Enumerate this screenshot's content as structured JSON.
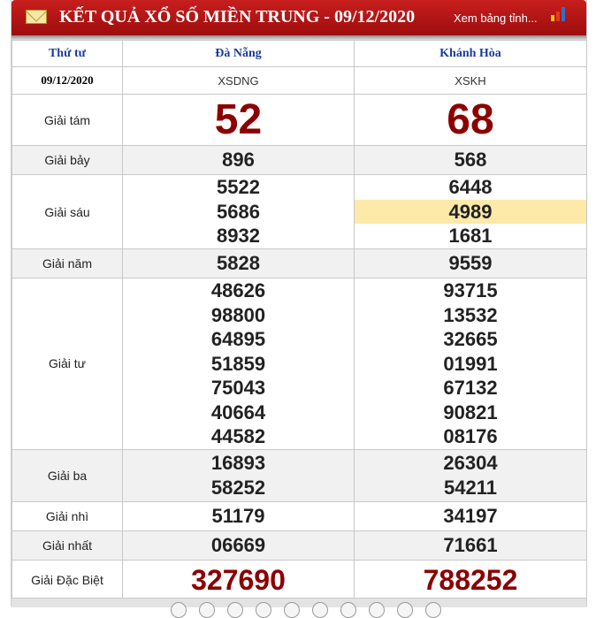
{
  "header": {
    "title": "KẾT QUẢ XỔ SỐ MIỀN TRUNG - 09/12/2020",
    "more_link": "Xem bảng tỉnh...",
    "chart_colors": [
      "#f0c419",
      "#e03b1b",
      "#2f6fd0"
    ]
  },
  "table": {
    "weekday": "Thứ tư",
    "date": "09/12/2020",
    "provinces": [
      {
        "name": "Đà Nẵng",
        "code": "XSDNG"
      },
      {
        "name": "Khánh Hòa",
        "code": "XSKH"
      }
    ],
    "prizes": {
      "g8": {
        "label": "Giải tám",
        "values": [
          [
            "52"
          ],
          [
            "68"
          ]
        ]
      },
      "g7": {
        "label": "Giải bảy",
        "values": [
          [
            "896"
          ],
          [
            "568"
          ]
        ]
      },
      "g6": {
        "label": "Giải sáu",
        "values": [
          [
            "5522",
            "5686",
            "8932"
          ],
          [
            "6448",
            "4989",
            "1681"
          ]
        ]
      },
      "g5": {
        "label": "Giải năm",
        "values": [
          [
            "5828"
          ],
          [
            "9559"
          ]
        ]
      },
      "g4": {
        "label": "Giải tư",
        "values": [
          [
            "48626",
            "98800",
            "64895",
            "51859",
            "75043",
            "40664",
            "44582"
          ],
          [
            "93715",
            "13532",
            "32665",
            "01991",
            "67132",
            "90821",
            "08176"
          ]
        ]
      },
      "g3": {
        "label": "Giải ba",
        "values": [
          [
            "16893",
            "58252"
          ],
          [
            "26304",
            "54211"
          ]
        ]
      },
      "g2": {
        "label": "Giải nhì",
        "values": [
          [
            "51179"
          ],
          [
            "34197"
          ]
        ]
      },
      "g1": {
        "label": "Giải nhất",
        "values": [
          [
            "06669"
          ],
          [
            "71661"
          ]
        ]
      },
      "gdb": {
        "label": "Giải Đặc Biệt",
        "values": [
          [
            "327690"
          ],
          [
            "788252"
          ]
        ]
      }
    },
    "highlight_color": "#fde9a8",
    "accent_color": "#8b0000",
    "header_color": "#1b3d9b"
  }
}
